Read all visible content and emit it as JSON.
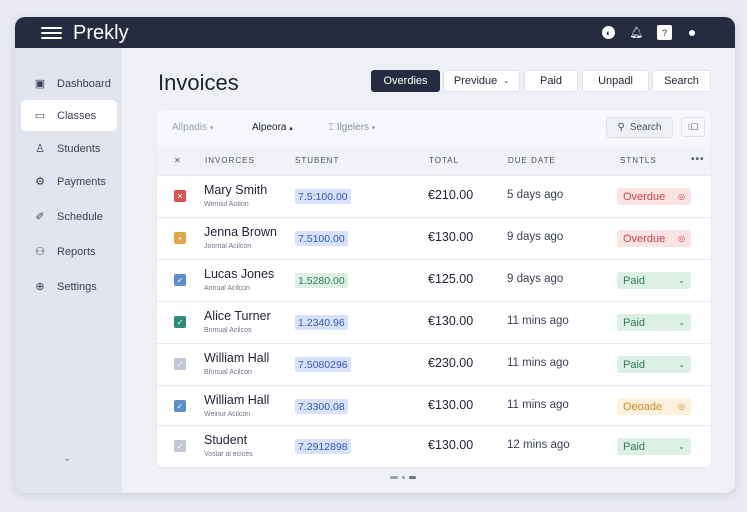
{
  "app": {
    "brand": "Prekly",
    "icons": [
      "globe-icon",
      "bell-icon",
      "help-icon",
      "dot-icon"
    ],
    "help_label": "?"
  },
  "sidebar": {
    "items": [
      {
        "label": "Dashboard",
        "icon": "dashboard-icon",
        "glyph": "▣"
      },
      {
        "label": "Classes",
        "icon": "classes-icon",
        "glyph": "▭",
        "active": true
      },
      {
        "label": "Students",
        "icon": "students-icon",
        "glyph": "♙"
      },
      {
        "label": "Payments",
        "icon": "payments-icon",
        "glyph": "⚙"
      },
      {
        "label": "Schedule",
        "icon": "schedule-icon",
        "glyph": "✐"
      },
      {
        "label": "Reports",
        "icon": "reports-icon",
        "glyph": "⚇"
      },
      {
        "label": "Settings",
        "icon": "settings-icon",
        "glyph": "⊕"
      }
    ],
    "collapse_glyph": "⌄"
  },
  "page": {
    "title": "Invoices"
  },
  "toolbar": {
    "overdue": "Overdies",
    "previous": "Previdue",
    "paid": "Paid",
    "unpaid": "Unpadl",
    "search": "Search"
  },
  "filters": {
    "f1": "Allpadis",
    "f2": "Alpeora",
    "f3": "Ilgelers",
    "search": "Search"
  },
  "table": {
    "headers": {
      "invoices": "INVORCES",
      "student": "STUBENT",
      "total": "TOTAL",
      "due": "DUE DATE",
      "status": "STNTLS"
    },
    "rows": [
      {
        "name": "Mary Smith",
        "sub": "Wemiul Aotion",
        "code": "7.5:100.00",
        "code_style": "blue",
        "total": "€210.00",
        "due": "5 days ago",
        "status": "Overdue",
        "status_style": "red",
        "check": "red",
        "mark": "✕"
      },
      {
        "name": "Jenna Brown",
        "sub": "Joornal Acilcon",
        "code": "7.5100.00",
        "code_style": "blue",
        "total": "€130.00",
        "due": "9 days ago",
        "status": "Overdue",
        "status_style": "red",
        "check": "amber",
        "mark": "▪"
      },
      {
        "name": "Lucas Jones",
        "sub": "Annual Acilcon",
        "code": "1.5280.00",
        "code_style": "green",
        "total": "€125.00",
        "due": "9 days ago",
        "status": "Paid",
        "status_style": "green",
        "check": "blue",
        "mark": "✓"
      },
      {
        "name": "Alice Turner",
        "sub": "Bnmual Acilcos",
        "code": "1.2340.96",
        "code_style": "blue",
        "total": "€130.00",
        "due": "11 mins ago",
        "status": "Paid",
        "status_style": "green",
        "check": "teal",
        "mark": "✓"
      },
      {
        "name": "William Hall",
        "sub": "Bhmual Acilcon",
        "code": "7.5080296",
        "code_style": "blue",
        "total": "€230.00",
        "due": "11 mins ago",
        "status": "Paid",
        "status_style": "green",
        "check": "grey",
        "mark": "✓"
      },
      {
        "name": "William Hall",
        "sub": "Weinur Acilcon",
        "code": "7.3300.08",
        "code_style": "blue",
        "total": "€130.00",
        "due": "11 mins ago",
        "status": "Oeoade",
        "status_style": "amber",
        "check": "blue",
        "mark": "✓"
      },
      {
        "name": "Student",
        "sub": "Vosiar al ecices",
        "code": "7.2912898",
        "code_style": "blue",
        "total": "€130.00",
        "due": "12 mins ago",
        "status": "Paid",
        "status_style": "green",
        "check": "grey",
        "mark": "✓"
      }
    ]
  },
  "colors": {
    "dark": "#262c40",
    "red": "#d9534f",
    "amber": "#e0a84a",
    "blue": "#5b8fc9",
    "teal": "#2f8a78",
    "grey": "#c3c7d6"
  }
}
